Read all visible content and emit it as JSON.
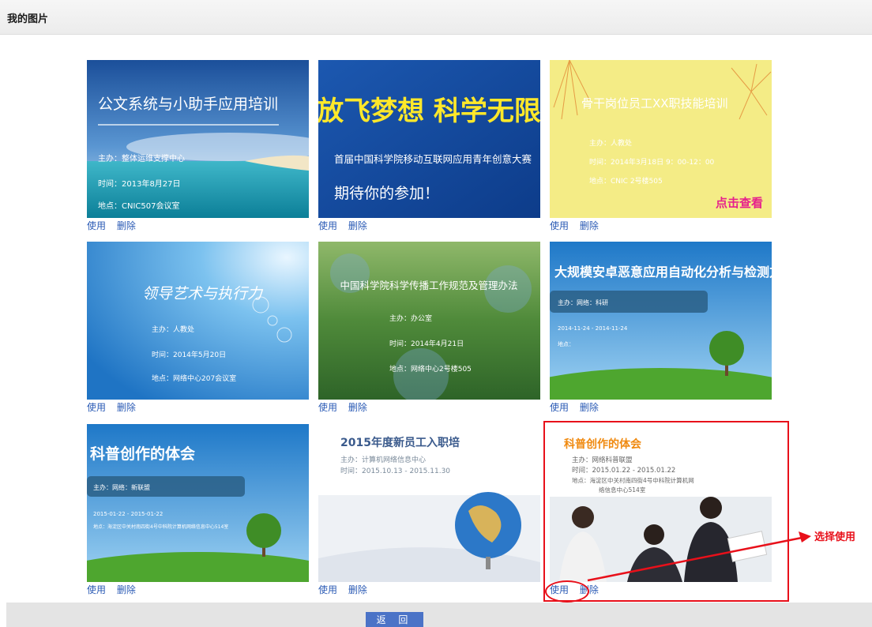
{
  "header": {
    "title": "我的图片"
  },
  "gallery": {
    "use_label": "使用",
    "delete_label": "删除",
    "items": [
      {
        "title": "公文系统与小助手应用培训",
        "lines": [
          "主办：整体运维支撑中心",
          "时间：2013年8月27日",
          "地点：CNIC507会议室"
        ]
      },
      {
        "title": "放飞梦想 科学无限",
        "lines": [
          "首届中国科学院移动互联网应用青年创意大赛",
          "期待你的参加！"
        ]
      },
      {
        "title": "骨干岗位员工XX职技能培训",
        "lines": [
          "主办：人教处",
          "时间：2014年3月18日 9：00-12：00",
          "地点：CNIC 2号楼505"
        ],
        "badge": "点击查看"
      },
      {
        "title": "领导艺术与执行力",
        "lines": [
          "主办：人教处",
          "时间：2014年5月20日",
          "地点：网络中心207会议室"
        ]
      },
      {
        "title": "中国科学院科学传播工作规范及管理办法",
        "lines": [
          "主办：办公室",
          "时间：2014年4月21日",
          "地点：网络中心2号楼505"
        ]
      },
      {
        "title": "大规模安卓恶意应用自动化分析与检测方法研讨",
        "lines": [
          "主办：网络：科研",
          "2014-11-24 - 2014-11-24",
          "地点："
        ]
      },
      {
        "title": "科普创作的体会",
        "lines": [
          "主办：网络：新联盟",
          "2015-01-22 - 2015-01-22",
          "地点：海淀区中关村南四街4号中科院计算机网络信息中心514室"
        ]
      },
      {
        "title": "2015年度新员工入职培",
        "lines": [
          "主办：计算机网络信息中心",
          "时间：2015.10.13 - 2015.11.30"
        ]
      },
      {
        "title": "科普创作的体会",
        "lines": [
          "主办：网络科普联盟",
          "时间：2015.01.22 - 2015.01.22",
          "地点：海淀区中关村南四街4号中科院计算机网",
          "络信息中心514室"
        ]
      }
    ]
  },
  "callout": {
    "text": "选择使用",
    "color": "#e8101a"
  },
  "footer": {
    "back_label": "返 回"
  },
  "colors": {
    "link": "#2b5bb5",
    "button": "#4b73c7"
  }
}
